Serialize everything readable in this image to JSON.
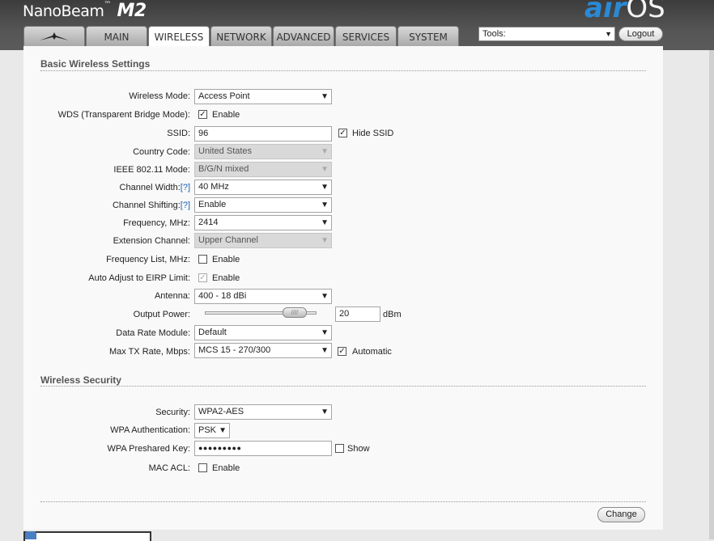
{
  "header": {
    "brand": "NanoBeam",
    "model": "M2",
    "airos_air": "air",
    "airos_os": "OS",
    "tabs": [
      "",
      "MAIN",
      "WIRELESS",
      "NETWORK",
      "ADVANCED",
      "SERVICES",
      "SYSTEM"
    ],
    "active_tab": "WIRELESS",
    "tools_value": "Tools:",
    "logout_label": "Logout"
  },
  "basic": {
    "title": "Basic Wireless Settings",
    "wireless_mode": {
      "label": "Wireless Mode:",
      "value": "Access Point"
    },
    "wds": {
      "label": "WDS (Transparent Bridge Mode):",
      "checked": true,
      "text": "Enable"
    },
    "ssid": {
      "label": "SSID:",
      "value": "96",
      "hide_label": "Hide SSID",
      "hide_checked": true
    },
    "country": {
      "label": "Country Code:",
      "value": "United States"
    },
    "ieee": {
      "label": "IEEE 802.11 Mode:",
      "value": "B/G/N mixed"
    },
    "channel_width": {
      "label": "Channel Width:",
      "help": "[?]",
      "value": "40 MHz"
    },
    "channel_shifting": {
      "label": "Channel Shifting:",
      "help": "[?]",
      "value": "Enable"
    },
    "frequency": {
      "label": "Frequency, MHz:",
      "value": "2414"
    },
    "extension": {
      "label": "Extension Channel:",
      "value": "Upper Channel"
    },
    "freq_list": {
      "label": "Frequency List, MHz:",
      "checked": false,
      "text": "Enable"
    },
    "eirp": {
      "label": "Auto Adjust to EIRP Limit:",
      "checked": true,
      "text": "Enable"
    },
    "antenna": {
      "label": "Antenna:",
      "value": "400 - 18 dBi"
    },
    "output_power": {
      "label": "Output Power:",
      "value": "20",
      "unit": "dBm",
      "slider_level": 0.8
    },
    "data_rate": {
      "label": "Data Rate Module:",
      "value": "Default"
    },
    "max_tx": {
      "label": "Max TX Rate, Mbps:",
      "value": "MCS 15 - 270/300",
      "auto_label": "Automatic",
      "auto_checked": true
    }
  },
  "security": {
    "title": "Wireless Security",
    "security": {
      "label": "Security:",
      "value": "WPA2-AES"
    },
    "wpa_auth": {
      "label": "WPA Authentication:",
      "value": "PSK"
    },
    "wpa_key": {
      "label": "WPA Preshared Key:",
      "value": "●●●●●●●●●",
      "show_label": "Show"
    },
    "mac_acl": {
      "label": "MAC ACL:",
      "checked": false,
      "text": "Enable"
    }
  },
  "footer": {
    "change_label": "Change"
  }
}
